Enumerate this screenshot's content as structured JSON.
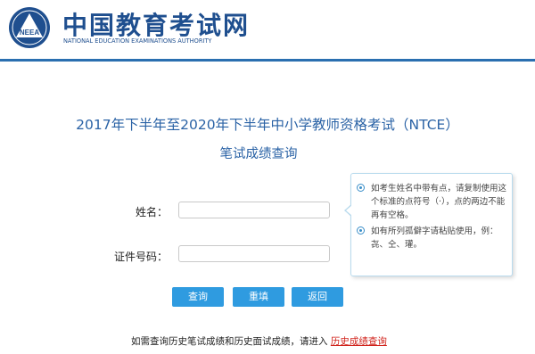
{
  "header": {
    "logo_title": "中国教育考试网",
    "logo_subtitle": "NATIONAL EDUCATION EXAMINATIONS AUTHORITY",
    "emblem_text": "NEEA"
  },
  "page": {
    "title": "2017年下半年至2020年下半年中小学教师资格考试（NTCE）",
    "subtitle": "笔试成绩查询"
  },
  "form": {
    "name_label": "姓名：",
    "name_value": "",
    "id_label": "证件号码：",
    "id_value": ""
  },
  "tip": {
    "items": [
      "如考生姓名中带有点，请复制使用这个标准的点符号（·），点的两边不能再有空格。",
      "如有所列孤僻字请粘贴使用，例：㐂、仝、瓘。"
    ]
  },
  "buttons": {
    "query": "查询",
    "reset": "重填",
    "back": "返回"
  },
  "footer": {
    "text": "如需查询历史笔试成绩和历史面试成绩，请进入",
    "link": "历史成绩查询"
  },
  "colors": {
    "brand": "#1f4f8f",
    "title": "#2b63a6",
    "button": "#2f9be0",
    "link": "#d0221b"
  }
}
